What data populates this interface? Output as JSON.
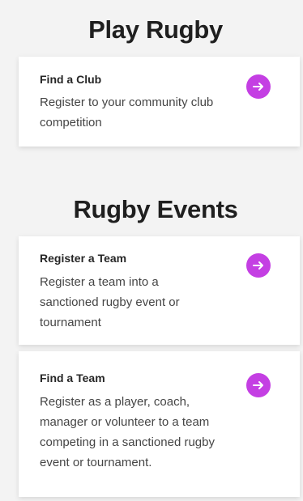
{
  "colors": {
    "background": "#f3f3f3",
    "card": "#ffffff",
    "accent": "#c43fe3",
    "text": "#262626"
  },
  "play_rugby": {
    "title": "Play Rugby",
    "cards": [
      {
        "heading": "Find a Club",
        "description": "Register to your community club competition",
        "icon": "arrow-right-icon"
      }
    ]
  },
  "rugby_events": {
    "title": "Rugby Events",
    "cards": [
      {
        "heading": "Register a Team",
        "description": "Register a team into a sanctioned rugby event or tournament",
        "icon": "arrow-right-icon"
      },
      {
        "heading": "Find a Team",
        "description": "Register as a player, coach, manager or volunteer to a team competing in a sanctioned rugby event or tournament.",
        "icon": "arrow-right-icon"
      }
    ]
  }
}
